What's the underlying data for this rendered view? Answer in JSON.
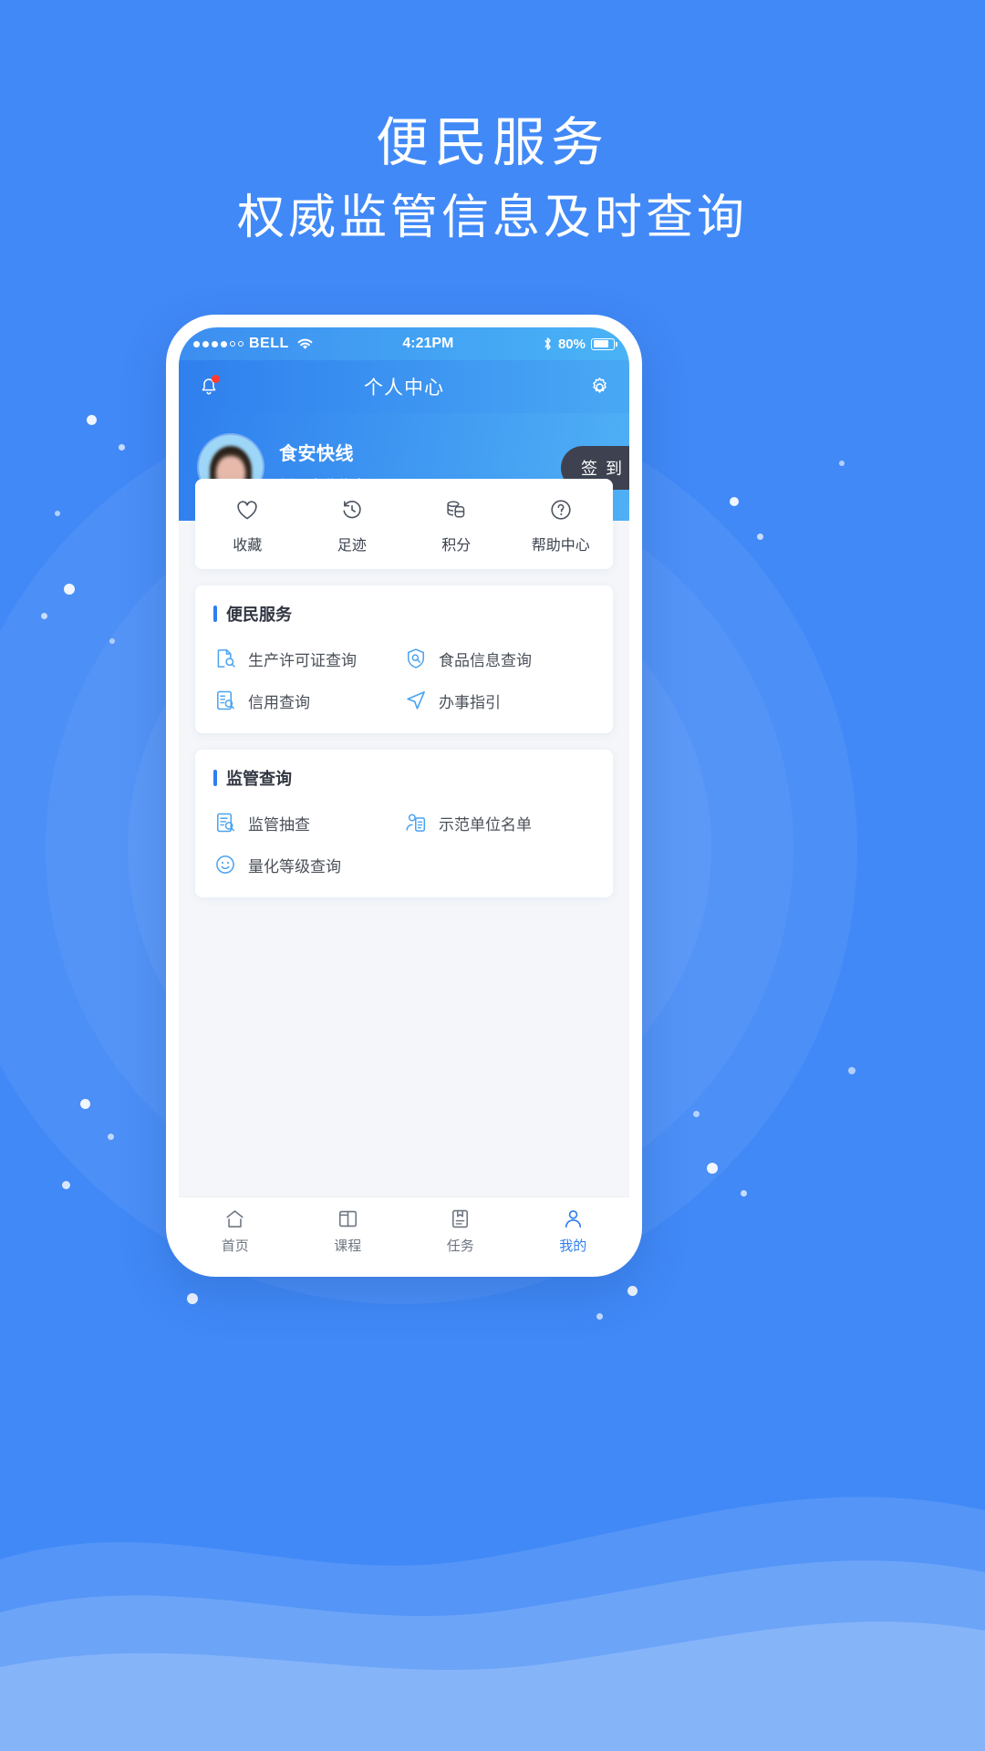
{
  "promo": {
    "headline": "便民服务",
    "subheadline": "权威监管信息及时查询",
    "background_color": "#4189f7",
    "text_color": "#ffffff"
  },
  "phone": {
    "status_bar": {
      "carrier": "BELL",
      "signal_dots_filled": 4,
      "signal_dots_total": 6,
      "wifi_icon": "wifi-icon",
      "time": "4:21PM",
      "bluetooth_icon": "bluetooth-icon",
      "battery_label": "80%",
      "battery_level": 80
    },
    "app_bar": {
      "notification_icon": "bell-icon",
      "has_notification_badge": true,
      "title": "个人中心",
      "settings_icon": "gear-icon",
      "gradient_start": "#2f7fee",
      "gradient_end": "#49a8f4"
    },
    "profile": {
      "avatar": "user-avatar",
      "name": "食安快线",
      "company": "暂无企业信息",
      "signin_label": "签 到",
      "signin_color": "#3e4250"
    },
    "quick_actions": [
      {
        "icon": "heart-icon",
        "label": "收藏"
      },
      {
        "icon": "history-icon",
        "label": "足迹"
      },
      {
        "icon": "coins-icon",
        "label": "积分"
      },
      {
        "icon": "question-icon",
        "label": "帮助中心"
      }
    ],
    "sections": [
      {
        "title": "便民服务",
        "accent": "#2f7fee",
        "items": [
          {
            "icon": "license-search-icon",
            "label": "生产许可证查询"
          },
          {
            "icon": "food-info-icon",
            "label": "食品信息查询"
          },
          {
            "icon": "credit-search-icon",
            "label": "信用查询"
          },
          {
            "icon": "guide-arrow-icon",
            "label": "办事指引"
          }
        ]
      },
      {
        "title": "监管查询",
        "accent": "#2f7fee",
        "items": [
          {
            "icon": "inspection-icon",
            "label": "监管抽查"
          },
          {
            "icon": "model-unit-icon",
            "label": "示范单位名单"
          },
          {
            "icon": "smiley-rating-icon",
            "label": "量化等级查询"
          }
        ]
      }
    ],
    "tab_bar": {
      "active_color": "#2f7fee",
      "inactive_color": "#6d7682",
      "tabs": [
        {
          "icon": "home-icon",
          "label": "首页",
          "active": false
        },
        {
          "icon": "book-icon",
          "label": "课程",
          "active": false
        },
        {
          "icon": "task-icon",
          "label": "任务",
          "active": false
        },
        {
          "icon": "person-icon",
          "label": "我的",
          "active": true
        }
      ]
    }
  }
}
